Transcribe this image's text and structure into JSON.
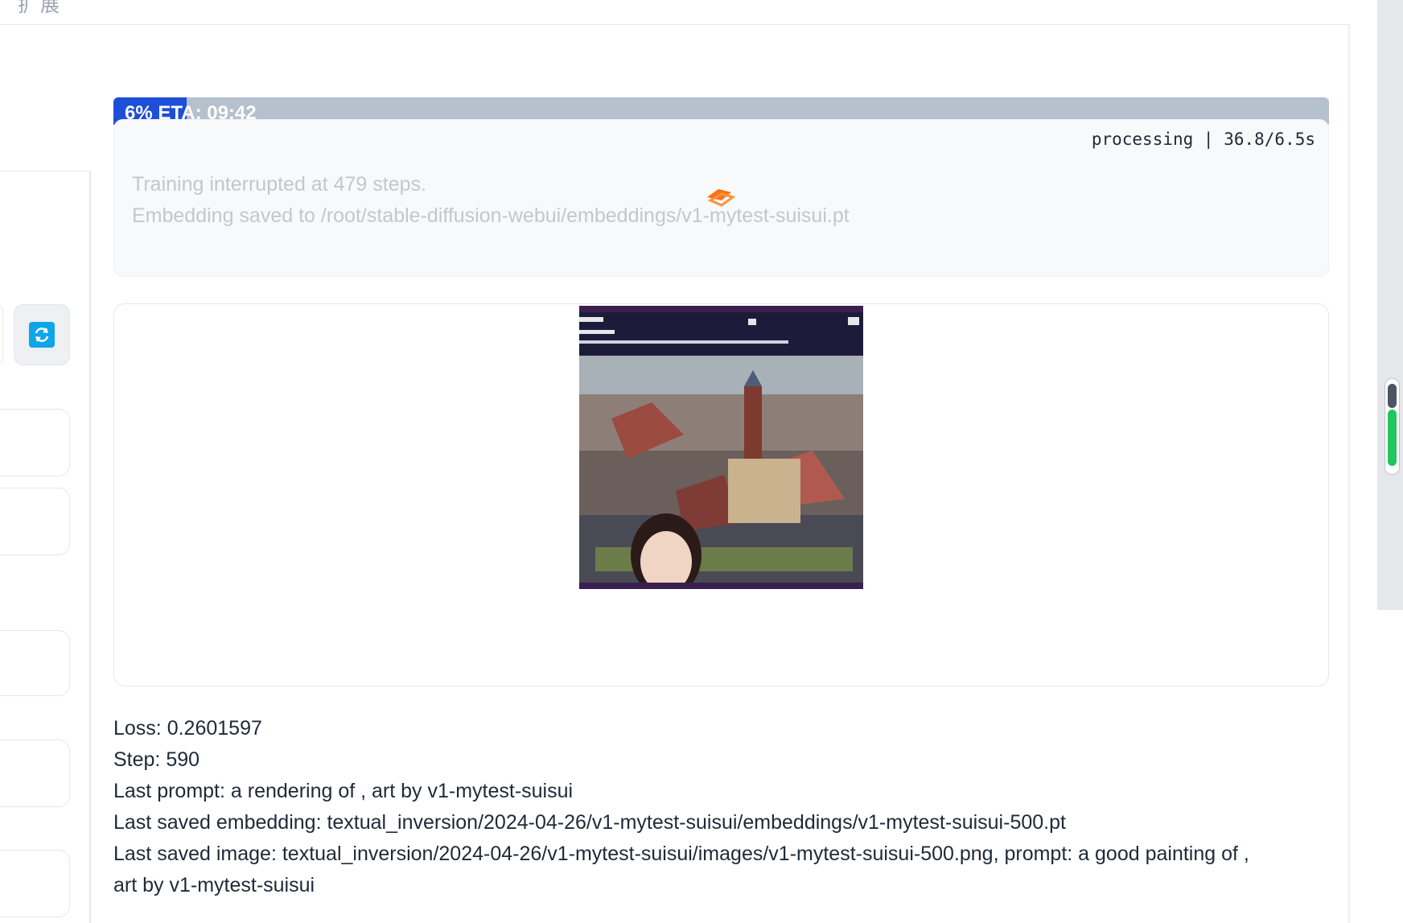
{
  "top_tab": "扩展",
  "progress": {
    "percent": 6,
    "label": "6% ETA: 09:42"
  },
  "status": {
    "timer": "processing | 36.8/6.5s",
    "line1": "Training interrupted at 479 steps.",
    "line2": "Embedding saved to /root/stable-diffusion-webui/embeddings/v1-mytest-suisui.pt"
  },
  "info": {
    "loss": "Loss: 0.2601597",
    "step": "Step: 590",
    "last_prompt": "Last prompt: a rendering of , art by v1-mytest-suisui",
    "last_saved_embedding": "Last saved embedding: textual_inversion/2024-04-26/v1-mytest-suisui/embeddings/v1-mytest-suisui-500.pt",
    "last_saved_image_1": "Last saved image: textual_inversion/2024-04-26/v1-mytest-suisui/images/v1-mytest-suisui-500.png, prompt: a good painting of ,",
    "last_saved_image_2": "art by v1-mytest-suisui"
  },
  "colors": {
    "progress_fill": "#1d4ed8",
    "progress_track": "#b5c1cd",
    "refresh_accent": "#0ea5e9",
    "spinner": "#f97316",
    "scroll_fill": "#22c55e"
  },
  "icons": {
    "refresh": "refresh-icon",
    "spinner": "loading-spinner-icon"
  }
}
